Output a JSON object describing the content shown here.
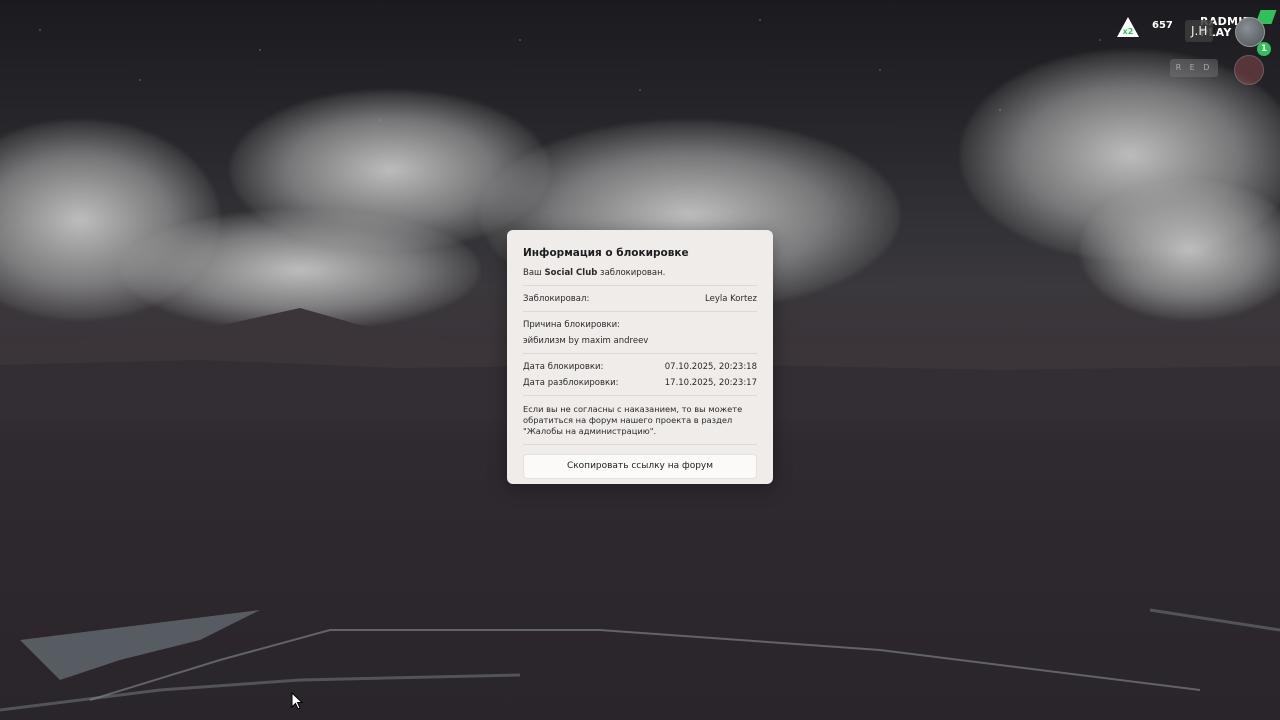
{
  "hud": {
    "online": "657",
    "player_tag": "J.H",
    "server_line1": "RADMIR",
    "server_line2": "PLAY",
    "logo_multiplier": "x2",
    "level": "1",
    "keys_label": "R E D"
  },
  "ban_modal": {
    "title": "Информация о блокировке",
    "status_prefix": "Ваш",
    "status_highlight": "Social Club",
    "status_suffix": "заблокирован.",
    "blocked_by_label": "Заблокировал:",
    "blocked_by_value": "Leyla Kortez",
    "reason_label": "Причина блокировки:",
    "reason_value": "эйбилизм by maxim andreev",
    "ban_date_label": "Дата блокировки:",
    "ban_date_value": "07.10.2025, 20:23:18",
    "unban_date_label": "Дата разблокировки:",
    "unban_date_value": "17.10.2025, 20:23:17",
    "notice": "Если вы не согласны с наказанием, то вы можете обратиться на форум нашего проекта в раздел \"Жалобы на администрацию\".",
    "copy_button_label": "Скопировать ссылку на форум"
  },
  "colors": {
    "modal_bg": "#efecea",
    "accent_green": "#31c05a"
  }
}
